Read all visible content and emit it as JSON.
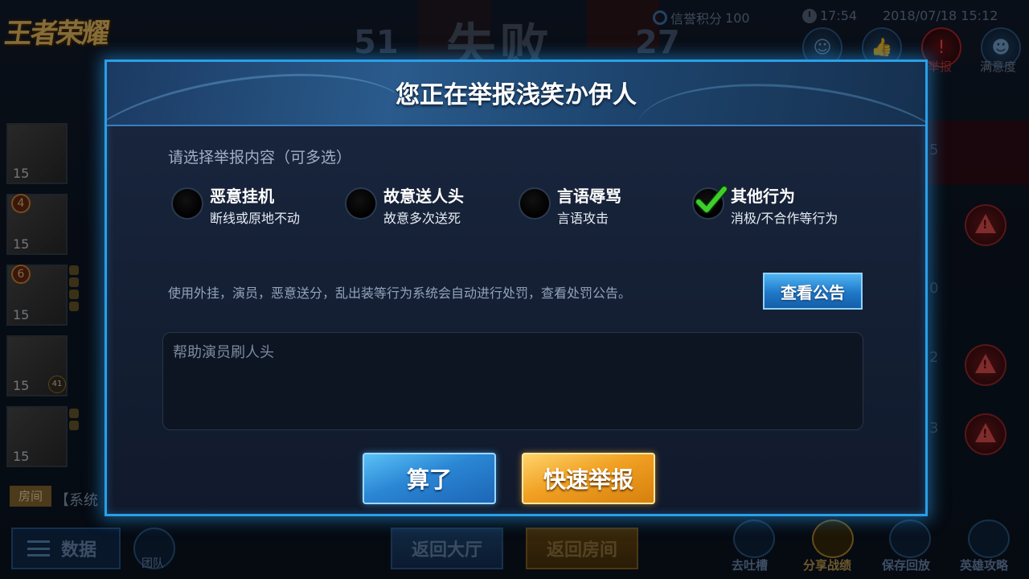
{
  "background": {
    "logo_text": "王者荣耀",
    "result": "失败",
    "score_left": "51",
    "score_right": "27",
    "credit_label": "信誉积分",
    "credit_value": "100",
    "clock_time": "17:54",
    "datetime": "2018/07/18 15:12",
    "top_icons": [
      {
        "icon": "friend-icon",
        "label": ""
      },
      {
        "icon": "like-icon",
        "label": ""
      },
      {
        "icon": "report-alert-icon",
        "label": "举报"
      },
      {
        "icon": "satisfaction-icon",
        "label": "满意度"
      }
    ],
    "roster": [
      {
        "level": "15",
        "badge": ""
      },
      {
        "level": "15",
        "badge": "4"
      },
      {
        "level": "15",
        "badge": "6"
      },
      {
        "level": "15",
        "badge": "",
        "rank": "41"
      },
      {
        "level": "15",
        "badge": ""
      }
    ],
    "room_tag": "房间",
    "room_system": "【系统",
    "bottom_data_label": "数据",
    "bottom_team_label": "团队",
    "btn_back_lobby": "返回大厅",
    "btn_back_room": "返回房间",
    "bottom_right": [
      {
        "icon": "chat-icon",
        "label": "去吐槽"
      },
      {
        "icon": "share-icon",
        "label": "分享战绩"
      },
      {
        "icon": "video-icon",
        "label": "保存回放"
      },
      {
        "icon": "hero-guide-icon",
        "label": "英雄攻略"
      }
    ]
  },
  "modal": {
    "title": "您正在举报浅笑か伊人",
    "prompt": "请选择举报内容（可多选）",
    "options": [
      {
        "title": "恶意挂机",
        "subtitle": "断线或原地不动",
        "checked": false
      },
      {
        "title": "故意送人头",
        "subtitle": "故意多次送死",
        "checked": false
      },
      {
        "title": "言语辱骂",
        "subtitle": "言语攻击",
        "checked": false
      },
      {
        "title": "其他行为",
        "subtitle": "消极/不合作等行为",
        "checked": true
      }
    ],
    "notice": "使用外挂，演员，恶意送分，乱出装等行为系统会自动进行处罚，查看处罚公告。",
    "notice_button": "查看公告",
    "textarea_value": "帮助演员刷人头",
    "cancel_button": "算了",
    "report_button": "快速举报"
  },
  "colors": {
    "accent_blue": "#2a9fe8",
    "check_green": "#3ecf2a",
    "report_gold": "#f0a022"
  }
}
